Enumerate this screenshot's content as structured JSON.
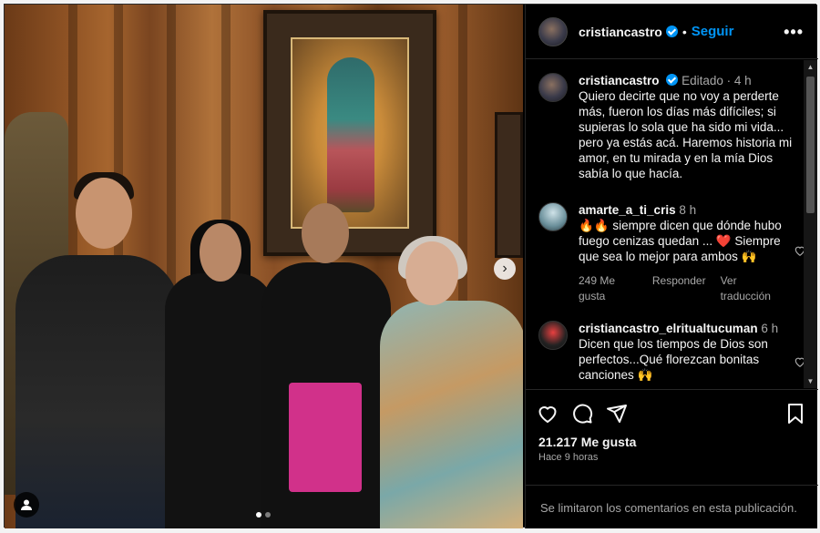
{
  "post": {
    "username": "cristiancastro",
    "follow_label": "Seguir",
    "separator": "•",
    "more_label": "•••"
  },
  "caption": {
    "username": "cristiancastro",
    "edited_label": "Editado",
    "separator": "·",
    "time": "4 h",
    "text": "Quiero decirte que no voy a perderte más, fueron los días más difíciles; si supieras lo sola que ha sido mi vida... pero ya estás acá. Haremos historia mi amor, en tu mirada y en la mía Dios sabía lo que hacía."
  },
  "comments": [
    {
      "username": "amarte_a_ti_cris",
      "time": "8 h",
      "text": "🔥🔥 siempre dicen que dónde hubo fuego cenizas quedan ... ❤️ Siempre que sea lo mejor para ambos 🙌",
      "likes": "249 Me gusta",
      "reply_label": "Responder",
      "translate_label": "Ver traducción"
    },
    {
      "username": "cristiancastro_elritualtucuman",
      "time": "6 h",
      "text": "Dicen que los tiempos de Dios son perfectos...Qué florezcan bonitas canciones 🙌"
    }
  ],
  "stats": {
    "likes": "21.217 Me gusta",
    "time_ago": "Hace 9 horas"
  },
  "footer": {
    "notice": "Se limitaron los comentarios en esta publicación."
  },
  "carousel": {
    "current": 1,
    "total": 2
  },
  "colors": {
    "background": "#000000",
    "accent": "#0095f6",
    "muted": "#a8a8a8"
  },
  "icons": [
    "verified-badge-icon",
    "more-options-icon",
    "heart-icon",
    "comment-icon",
    "share-icon",
    "bookmark-icon",
    "next-arrow-icon",
    "user-tag-icon"
  ]
}
